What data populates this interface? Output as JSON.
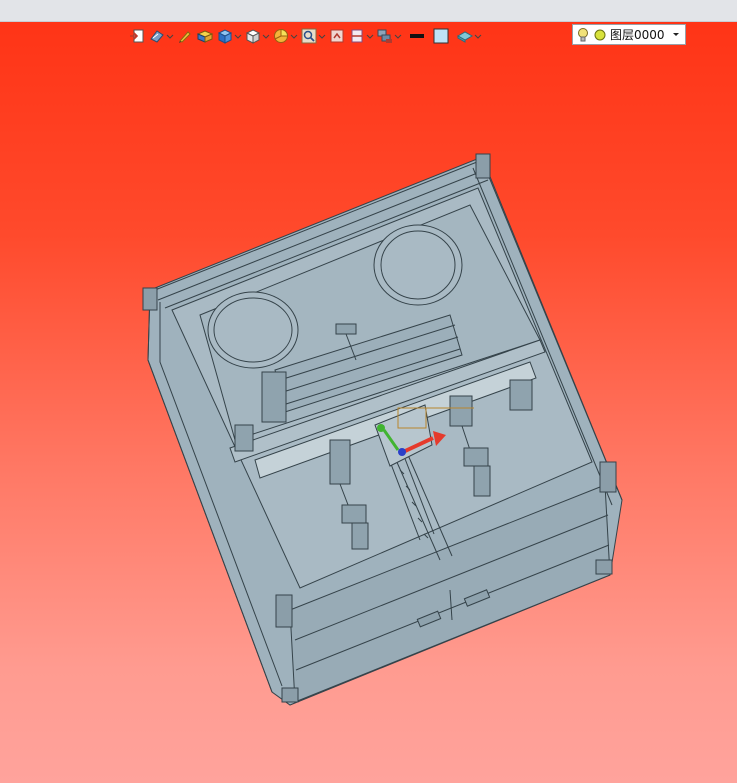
{
  "toolbar": {
    "buttons": [
      {
        "icon": "exit-view-icon",
        "dropdown": false
      },
      {
        "icon": "render-style-icon",
        "dropdown": true
      },
      {
        "icon": "pencil-icon",
        "dropdown": false
      },
      {
        "icon": "shaded-box-icon",
        "dropdown": false
      },
      {
        "icon": "view-cube-icon",
        "dropdown": true
      },
      {
        "icon": "white-cube-icon",
        "dropdown": true
      },
      {
        "icon": "pie-section-icon",
        "dropdown": true
      },
      {
        "icon": "zoom-fit-icon",
        "dropdown": true
      },
      {
        "icon": "snapshot-icon",
        "dropdown": false
      },
      {
        "icon": "clip-plane-icon",
        "dropdown": true
      },
      {
        "icon": "layers-stack-icon",
        "dropdown": true
      },
      {
        "icon": "line-color-icon",
        "dropdown": false
      },
      {
        "icon": "fill-color-icon",
        "dropdown": false
      },
      {
        "icon": "surface-icon",
        "dropdown": true
      }
    ],
    "layer": {
      "label": "图层0000",
      "bulb_color": "#f1e27a",
      "sun_color": "#d8e23c"
    }
  },
  "viewport": {
    "background_top": "#ff3416",
    "background_bottom": "#ffa39c",
    "model_color": "#9fb2bd",
    "edge_color": "#35434a",
    "triad": {
      "x_axis_color": "#e53a2c",
      "y_axis_color": "#41b431",
      "z_axis_color": "#2a40c8"
    }
  }
}
